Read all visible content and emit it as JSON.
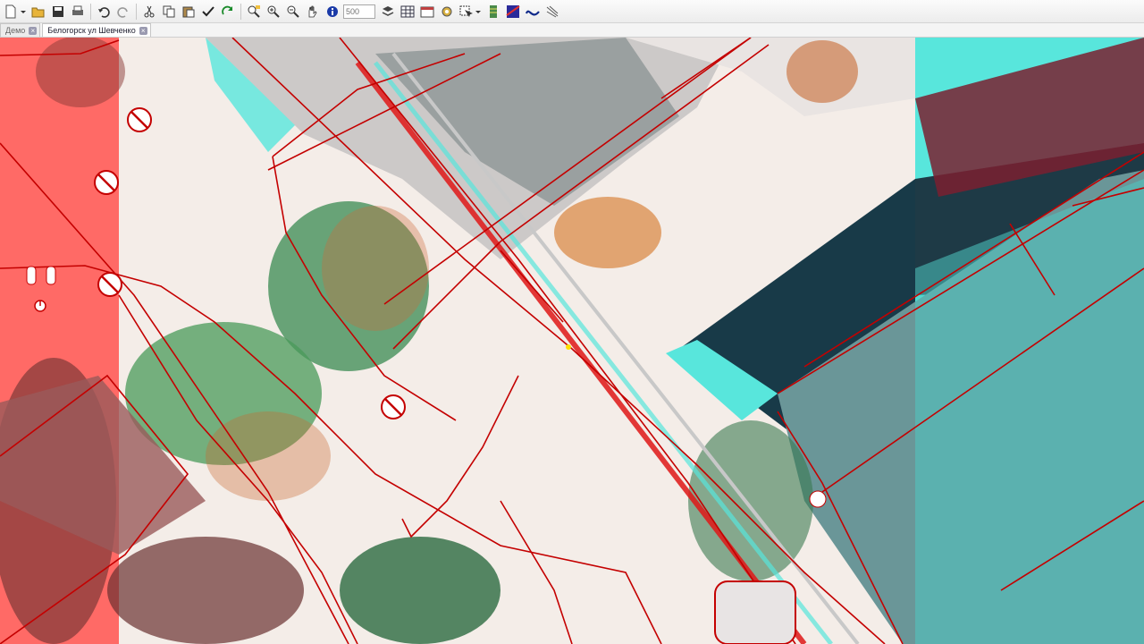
{
  "toolbar": {
    "scale_placeholder": "500",
    "buttons": [
      "new-document-icon",
      "open-folder-icon",
      "save-icon",
      "print-icon",
      "undo-icon",
      "redo-icon",
      "cut-icon",
      "copy-icon",
      "paste-icon",
      "check-icon",
      "refresh-icon",
      "zoom-extent-icon",
      "zoom-in-icon",
      "zoom-out-icon",
      "pan-hand-icon",
      "info-icon",
      "layers-icon",
      "table-icon",
      "properties-icon",
      "settings-icon",
      "select-icon",
      "database-icon",
      "raster-icon",
      "curve-icon",
      "tool-icon"
    ]
  },
  "tabs": [
    {
      "label": "Демо"
    },
    {
      "label": "Белогорск ул Шевченко"
    }
  ],
  "colors": {
    "anaglyph_red": "#ff5a5a",
    "anaglyph_cyan": "#4ee6e0",
    "parcel_line": "#c40000",
    "vegetation": "#3c9a5a",
    "road": "#f3ebe6"
  }
}
